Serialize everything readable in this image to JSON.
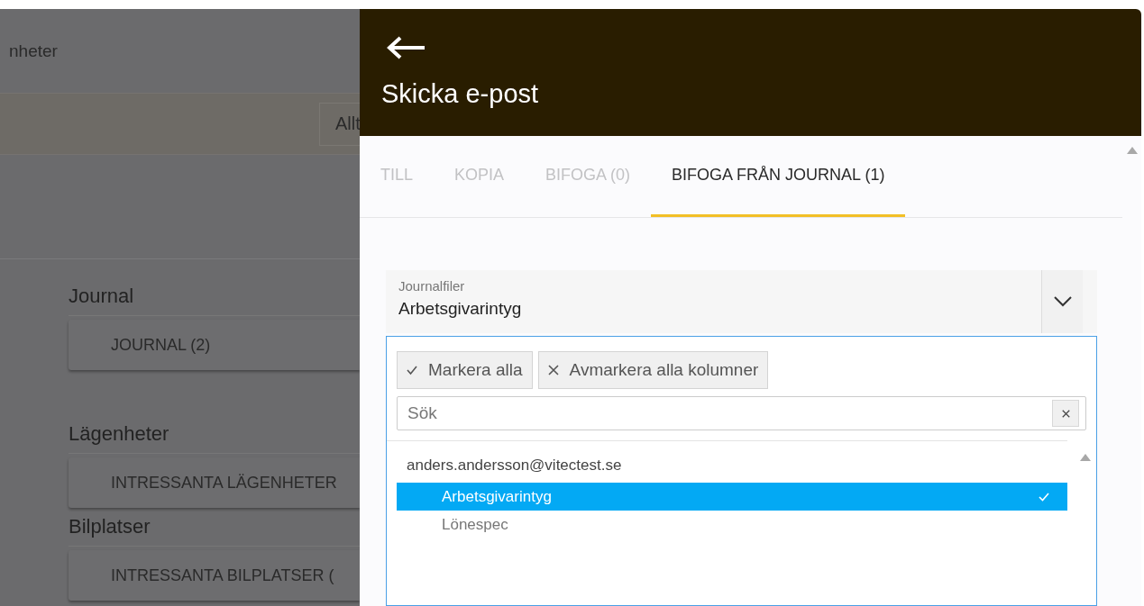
{
  "background": {
    "header_text": "nheter",
    "filter_button": "Allt",
    "sections": [
      {
        "heading": "Journal",
        "button": "JOURNAL (2)"
      },
      {
        "heading": "Lägenheter",
        "button": "INTRESSANTA LÄGENHETER"
      },
      {
        "heading": "Bilplatser",
        "button": "INTRESSANTA BILPLATSER ("
      }
    ]
  },
  "dialog": {
    "title": "Skicka e-post",
    "tabs": [
      {
        "label": "TILL",
        "selected": false
      },
      {
        "label": "KOPIA",
        "selected": false
      },
      {
        "label": "BIFOGA (0)",
        "selected": false
      },
      {
        "label": "BIFOGA FRÅN JOURNAL (1)",
        "selected": true
      }
    ],
    "field": {
      "label": "Journalfiler",
      "value": "Arbetsgivarintyg"
    },
    "dropdown": {
      "select_all": "Markera alla",
      "deselect_all": "Avmarkera alla kolumner",
      "search": {
        "placeholder": "Sök"
      },
      "groups": [
        {
          "name": "anders.andersson@vitectest.se",
          "items": [
            {
              "label": "Arbetsgivarintyg",
              "selected": true
            },
            {
              "label": "Lönespec",
              "selected": false
            }
          ]
        }
      ]
    }
  }
}
